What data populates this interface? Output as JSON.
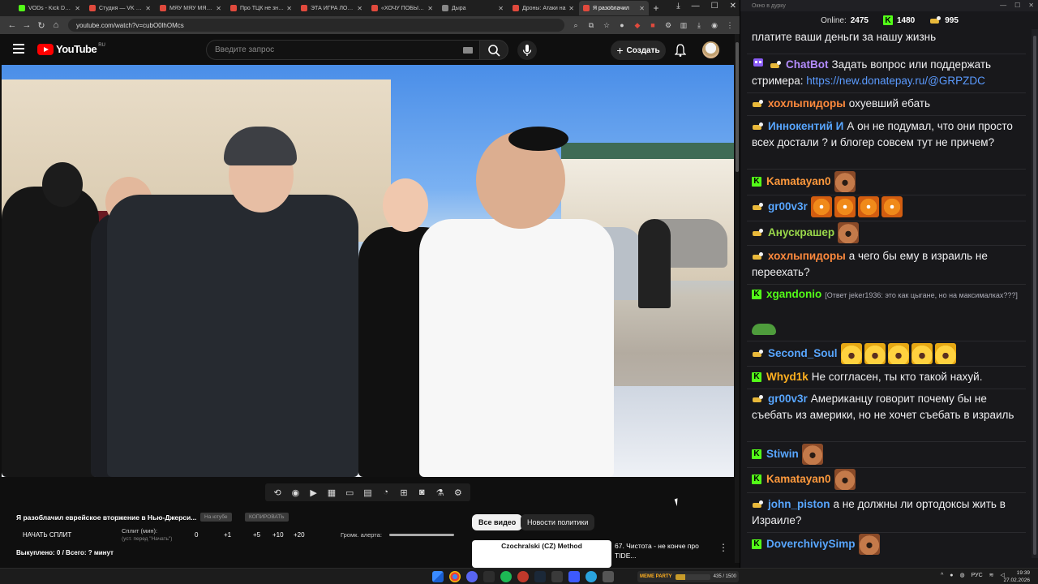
{
  "browser": {
    "tabs": [
      {
        "label": "VODs - Kick Dashb",
        "color": "#53fc18",
        "active": false
      },
      {
        "label": "Студия — VK Видео",
        "color": "#e04a3d",
        "active": false
      },
      {
        "label": "МЯУ МЯУ МЯУ М",
        "color": "#e04a3d",
        "active": false
      },
      {
        "label": "Про ТЦК не знаю",
        "color": "#e04a3d",
        "active": false
      },
      {
        "label": "ЭТА ИГРА ЛОМАЕ",
        "color": "#e04a3d",
        "active": false
      },
      {
        "label": "«ХОЧУ ПОБЫСТРЕ",
        "color": "#e04a3d",
        "active": false
      },
      {
        "label": "Дыра",
        "color": "#888888",
        "active": false
      },
      {
        "label": "Дроны: Атаки на",
        "color": "#e04a3d",
        "active": false
      },
      {
        "label": "Я разоблачил",
        "color": "#e04a3d",
        "active": true
      }
    ],
    "url": "youtube.com/watch?v=cubO0lhOMcs"
  },
  "youtube": {
    "logo": "YouTube",
    "region": "RU",
    "search_placeholder": "Введите запрос",
    "create_label": "Создать",
    "video_title": "Я разоблачил еврейское вторжение в Нью-Джерси...",
    "open_btn": "На ютубе",
    "copy_btn": "КОПИРОВАТЬ",
    "split": {
      "start": "НАЧАТЬ СПЛИТ",
      "label": "Сплит (мин):",
      "sub": "(уст. перед \"Начать\")",
      "nums": [
        "0",
        "+1",
        "+5",
        "+10",
        "+20"
      ]
    },
    "alert_volume_label": "Громк. алерта:",
    "bought": "Выкуплено: 0 / Всего: ? минут",
    "chips": [
      "Все видео",
      "Новости политики"
    ],
    "reco": {
      "thumb_title": "Czochralski (CZ) Method",
      "title": "67. Чистота - не конче про TIDE..."
    }
  },
  "chat": {
    "window_title": "Окно в дурку",
    "online_label": "Online:",
    "online": "2475",
    "kick_count": "1480",
    "twitch_count": "995",
    "messages": [
      {
        "badge": "twitch",
        "user": "",
        "color": "#e0a030",
        "text": "платите ваши деньги за нашу жизнь"
      },
      {
        "badge": "bot",
        "user": "ChatBot",
        "color": "#b48cff",
        "text": "Задать вопрос или поддержать стримера: ",
        "link": "https://new.donatepay.ru/@GRPZDC"
      },
      {
        "badge": "twitch",
        "user": "хохлыпидоры",
        "color": "#ff8a3d",
        "text": "охуевший ебать"
      },
      {
        "badge": "twitch",
        "user": "Иннокентий И",
        "color": "#58a6ff",
        "text": "А он не подумал, что они просто всех достали ? и блогер совсем тут не причем?"
      },
      {
        "badge": "kick",
        "user": "Kamatayan0",
        "color": "#ff9a3d",
        "text": ""
      },
      {
        "badge": "twitch",
        "user": "gr00v3r",
        "color": "#58a6ff",
        "text": ""
      },
      {
        "badge": "twitch",
        "user": "Анускрашер",
        "color": "#9ad84a",
        "text": ""
      },
      {
        "badge": "twitch",
        "user": "хохлыпидоры",
        "color": "#ff8a3d",
        "text": "а чего бы ему в израиль не переехать?"
      },
      {
        "badge": "kick",
        "user": "xgandonio",
        "color": "#53fc18",
        "reply": "[Ответ jeker1936: это как цыгане, но на максималках???]"
      },
      {
        "badge": "twitch",
        "user": "Second_Soul",
        "color": "#58a6ff",
        "text": ""
      },
      {
        "badge": "kick",
        "user": "Whyd1k",
        "color": "#ffb020",
        "text": "Не соггласен, ты кто такой нахуй."
      },
      {
        "badge": "twitch",
        "user": "gr00v3r",
        "color": "#58a6ff",
        "text": "Американцу говорит почему бы не съебать из америки, но не хочет съебать в израиль"
      },
      {
        "badge": "kick",
        "user": "Stiwin",
        "color": "#58a6ff",
        "text": ""
      },
      {
        "badge": "kick",
        "user": "Kamatayan0",
        "color": "#ff9a3d",
        "text": ""
      },
      {
        "badge": "twitch",
        "user": "john_piston",
        "color": "#58a6ff",
        "text": "а не должны ли ортодоксы жить в Израиле?"
      },
      {
        "badge": "kick",
        "user": "DoverchiviySimp",
        "color": "#58a6ff",
        "text": ""
      }
    ]
  },
  "taskbar": {
    "widget_logo": "MEME PARTY",
    "widget_value": "435 / 1500",
    "widget_progress": 0.29,
    "lang": "РУС",
    "time": "19:39",
    "date": "27.02.2026"
  }
}
